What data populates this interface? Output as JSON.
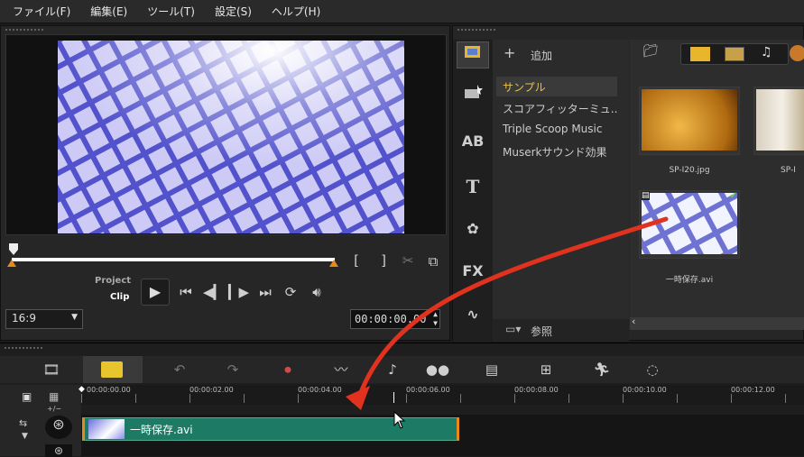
{
  "menubar": {
    "items": [
      "ファイル(F)",
      "編集(E)",
      "ツール(T)",
      "設定(S)",
      "ヘルプ(H)"
    ]
  },
  "preview": {
    "mode_project": "Project",
    "mode_clip": "Clip",
    "aspect_ratio": "16:9",
    "timecode": "00:00:00.00"
  },
  "library": {
    "add_label": "追加",
    "browse_label": "参照",
    "folders": [
      "サンプル",
      "スコアフィッターミュ...",
      "Triple Scoop Music",
      "Muserkサウンド効果"
    ],
    "selected_folder_color": "#e8c34a",
    "side_icons": [
      "media-icon",
      "transition-icon",
      "title-icon",
      "text-icon",
      "graphics-icon",
      "fx-icon",
      "path-icon"
    ],
    "side_text": {
      "ab": "AB",
      "t": "T",
      "fx": "FX"
    },
    "thumbnails": [
      {
        "label": "SP-I20.jpg"
      },
      {
        "label": "SP-I"
      },
      {
        "label": "一時保存.avi"
      }
    ]
  },
  "timeline": {
    "ruler_ticks": [
      "00:00:00.00",
      "00:00:02.00",
      "00:00:04.00",
      "00:00:06.00",
      "00:00:08.00",
      "00:00:10.00",
      "00:00:12.00"
    ],
    "clip_name": "一時保存.avi",
    "track_controls": "+/−",
    "clip_color": "#1d7a64"
  },
  "colors": {
    "accent_orange": "#e88a1a",
    "annotation_arrow": "#e0321e"
  }
}
